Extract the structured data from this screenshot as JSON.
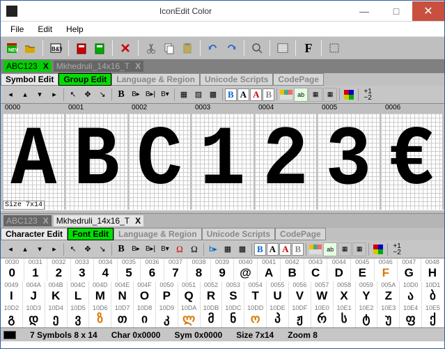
{
  "window": {
    "title": "IconEdit Color"
  },
  "menu": {
    "file": "File",
    "edit": "Edit",
    "help": "Help"
  },
  "win_btns": {
    "min": "—",
    "max": "□",
    "close": "✕"
  },
  "file_tabs_top": [
    {
      "name": "ABC123",
      "close": "X",
      "active": true
    },
    {
      "name": "Mkhedruli_14x16_T",
      "close": "X",
      "active": false
    }
  ],
  "file_tabs_bottom": [
    {
      "name": "ABC123",
      "close": "X",
      "active": false
    },
    {
      "name": "Mkhedruli_14x16_T",
      "close": "X",
      "active": true
    }
  ],
  "mode_tabs_top": [
    "Symbol Edit",
    "Group Edit",
    "Language & Region",
    "Unicode Scripts",
    "CodePage"
  ],
  "mode_tabs_top_active": 1,
  "mode_tabs_bottom": [
    "Character Edit",
    "Font Edit",
    "Language & Region",
    "Unicode Scripts",
    "CodePage"
  ],
  "mode_tabs_bottom_active": 1,
  "glyph_codes": [
    "0000",
    "0001",
    "0002",
    "0003",
    "0004",
    "0005",
    "0006"
  ],
  "glyph_chars": [
    "A",
    "B",
    "C",
    "1",
    "2",
    "3",
    "€"
  ],
  "size_tag": "Size 7x14",
  "font_rows": [
    {
      "codes": [
        "0030",
        "0031",
        "0032",
        "0033",
        "0034",
        "0035",
        "0036",
        "0037",
        "0038",
        "0039",
        "0040",
        "0041",
        "0042",
        "0043",
        "0044",
        "0045",
        "0046",
        "0047",
        "0048"
      ],
      "glyphs": [
        "0",
        "1",
        "2",
        "3",
        "4",
        "5",
        "6",
        "7",
        "8",
        "9",
        "@",
        "A",
        "B",
        "C",
        "D",
        "E",
        "F",
        "G",
        "H"
      ],
      "orange": [
        16
      ]
    },
    {
      "codes": [
        "0049",
        "004A",
        "004B",
        "004C",
        "004D",
        "004E",
        "004F",
        "0050",
        "0051",
        "0052",
        "0053",
        "0054",
        "0055",
        "0056",
        "0057",
        "0058",
        "0059",
        "005A",
        "10D0",
        "10D1"
      ],
      "glyphs": [
        "I",
        "J",
        "K",
        "L",
        "M",
        "N",
        "O",
        "P",
        "Q",
        "R",
        "S",
        "T",
        "U",
        "V",
        "W",
        "X",
        "Y",
        "Z",
        "ა",
        "ბ"
      ],
      "orange": []
    },
    {
      "codes": [
        "10D2",
        "10D3",
        "10D4",
        "10D5",
        "10D6",
        "10D7",
        "10D8",
        "10D9",
        "10DA",
        "10DB",
        "10DC",
        "10DD",
        "10DE",
        "10DF",
        "10E0",
        "10E1",
        "10E2",
        "10E3",
        "10E4",
        "10E5"
      ],
      "glyphs": [
        "გ",
        "დ",
        "ე",
        "ვ",
        "ზ",
        "თ",
        "ი",
        "კ",
        "ლ",
        "მ",
        "ნ",
        "ო",
        "პ",
        "ჟ",
        "რ",
        "ს",
        "ტ",
        "უ",
        "ფ",
        "ქ"
      ],
      "orange": [
        4,
        8,
        11
      ]
    }
  ],
  "status": {
    "symbols": "7 Symbols 8 x 14",
    "char": "Char 0x0000",
    "sym": "Sym 0x0000",
    "size": "Size 7x14",
    "zoom": "Zoom 8"
  },
  "tool_icons": [
    "new",
    "open",
    "bw",
    "export",
    "import",
    "delete",
    "cut",
    "copy",
    "paste",
    "undo",
    "redo",
    "zoom",
    "preview",
    "font",
    "select-all"
  ]
}
